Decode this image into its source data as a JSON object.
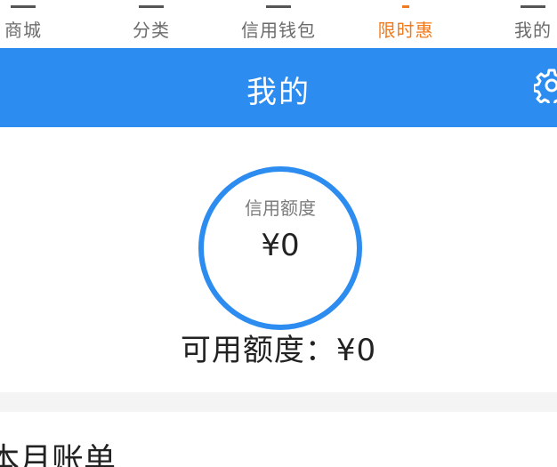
{
  "tabs": [
    {
      "label": "商城",
      "active": false,
      "icon": "home-icon"
    },
    {
      "label": "分类",
      "active": false,
      "icon": "category-icon"
    },
    {
      "label": "信用钱包",
      "active": false,
      "icon": "wallet-icon"
    },
    {
      "label": "限时惠",
      "active": true,
      "icon": "flash-sale-icon"
    },
    {
      "label": "我的",
      "active": false,
      "icon": "user-icon"
    }
  ],
  "header": {
    "title": "我的",
    "settings_icon": "gear-icon"
  },
  "credit": {
    "label": "信用额度",
    "value": "¥0"
  },
  "available": {
    "text": "可用额度：¥0"
  },
  "bill": {
    "title": "本月账单"
  },
  "colors": {
    "primary_blue": "#2c8cf0",
    "active_orange": "#f07a1d",
    "tab_gray": "#6b6b6b"
  }
}
